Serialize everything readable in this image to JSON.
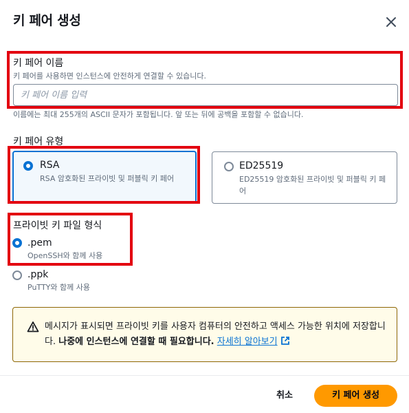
{
  "dialog": {
    "title": "키 페어 생성",
    "close_icon": "close-icon"
  },
  "key_name": {
    "label": "키 페어 이름",
    "description": "키 페어를 사용하면 인스턴스에 안전하게 연결할 수 있습니다.",
    "placeholder": "키 페어 이름 입력",
    "value": "",
    "constraint": "이름에는 최대 255개의 ASCII 문자가 포함됩니다. 앞 또는 뒤에 공백을 포함할 수 없습니다."
  },
  "key_type": {
    "label": "키 페어 유형",
    "options": [
      {
        "label": "RSA",
        "description": "RSA 암호화된 프라이빗 및 퍼블릭 키 페어",
        "selected": true
      },
      {
        "label": "ED25519",
        "description": "ED25519 암호화된 프라이빗 및 퍼블릭 키 페어",
        "selected": false
      }
    ]
  },
  "key_format": {
    "label": "프라이빗 키 파일 형식",
    "options": [
      {
        "label": ".pem",
        "description": "OpenSSH와 함께 사용",
        "selected": true
      },
      {
        "label": ".ppk",
        "description": "PuTTY와 함께 사용",
        "selected": false
      }
    ]
  },
  "warning": {
    "icon": "warning-icon",
    "text": "메시지가 표시되면 프라이빗 키를 사용자 컴퓨터의 안전하고 액세스 가능한 위치에 저장합니다.",
    "bold_text": "나중에 인스턴스에 연결할 때 필요합니다.",
    "link_text": "자세히 알아보기",
    "link_icon": "external-link-icon"
  },
  "footer": {
    "cancel_label": "취소",
    "create_label": "키 페어 생성"
  },
  "colors": {
    "highlight": "#e3000f",
    "accent": "#0972d3",
    "primary_button": "#ff9900",
    "warning_bg": "#fffce9"
  }
}
